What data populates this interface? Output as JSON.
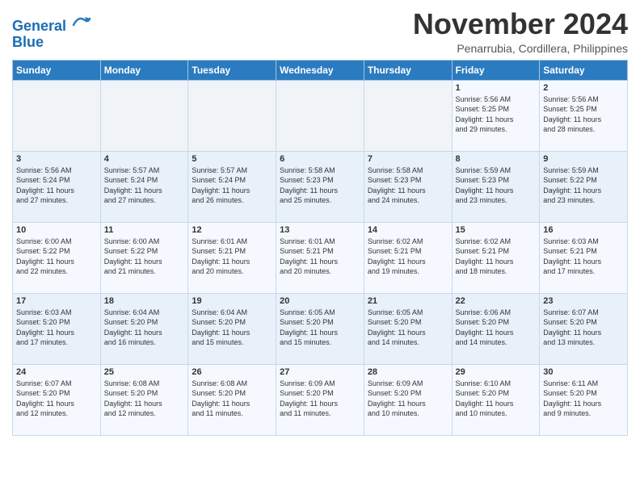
{
  "header": {
    "logo_line1": "General",
    "logo_line2": "Blue",
    "month": "November 2024",
    "location": "Penarrubia, Cordillera, Philippines"
  },
  "weekdays": [
    "Sunday",
    "Monday",
    "Tuesday",
    "Wednesday",
    "Thursday",
    "Friday",
    "Saturday"
  ],
  "weeks": [
    [
      {
        "day": "",
        "info": ""
      },
      {
        "day": "",
        "info": ""
      },
      {
        "day": "",
        "info": ""
      },
      {
        "day": "",
        "info": ""
      },
      {
        "day": "",
        "info": ""
      },
      {
        "day": "1",
        "info": "Sunrise: 5:56 AM\nSunset: 5:25 PM\nDaylight: 11 hours\nand 29 minutes."
      },
      {
        "day": "2",
        "info": "Sunrise: 5:56 AM\nSunset: 5:25 PM\nDaylight: 11 hours\nand 28 minutes."
      }
    ],
    [
      {
        "day": "3",
        "info": "Sunrise: 5:56 AM\nSunset: 5:24 PM\nDaylight: 11 hours\nand 27 minutes."
      },
      {
        "day": "4",
        "info": "Sunrise: 5:57 AM\nSunset: 5:24 PM\nDaylight: 11 hours\nand 27 minutes."
      },
      {
        "day": "5",
        "info": "Sunrise: 5:57 AM\nSunset: 5:24 PM\nDaylight: 11 hours\nand 26 minutes."
      },
      {
        "day": "6",
        "info": "Sunrise: 5:58 AM\nSunset: 5:23 PM\nDaylight: 11 hours\nand 25 minutes."
      },
      {
        "day": "7",
        "info": "Sunrise: 5:58 AM\nSunset: 5:23 PM\nDaylight: 11 hours\nand 24 minutes."
      },
      {
        "day": "8",
        "info": "Sunrise: 5:59 AM\nSunset: 5:23 PM\nDaylight: 11 hours\nand 23 minutes."
      },
      {
        "day": "9",
        "info": "Sunrise: 5:59 AM\nSunset: 5:22 PM\nDaylight: 11 hours\nand 23 minutes."
      }
    ],
    [
      {
        "day": "10",
        "info": "Sunrise: 6:00 AM\nSunset: 5:22 PM\nDaylight: 11 hours\nand 22 minutes."
      },
      {
        "day": "11",
        "info": "Sunrise: 6:00 AM\nSunset: 5:22 PM\nDaylight: 11 hours\nand 21 minutes."
      },
      {
        "day": "12",
        "info": "Sunrise: 6:01 AM\nSunset: 5:21 PM\nDaylight: 11 hours\nand 20 minutes."
      },
      {
        "day": "13",
        "info": "Sunrise: 6:01 AM\nSunset: 5:21 PM\nDaylight: 11 hours\nand 20 minutes."
      },
      {
        "day": "14",
        "info": "Sunrise: 6:02 AM\nSunset: 5:21 PM\nDaylight: 11 hours\nand 19 minutes."
      },
      {
        "day": "15",
        "info": "Sunrise: 6:02 AM\nSunset: 5:21 PM\nDaylight: 11 hours\nand 18 minutes."
      },
      {
        "day": "16",
        "info": "Sunrise: 6:03 AM\nSunset: 5:21 PM\nDaylight: 11 hours\nand 17 minutes."
      }
    ],
    [
      {
        "day": "17",
        "info": "Sunrise: 6:03 AM\nSunset: 5:20 PM\nDaylight: 11 hours\nand 17 minutes."
      },
      {
        "day": "18",
        "info": "Sunrise: 6:04 AM\nSunset: 5:20 PM\nDaylight: 11 hours\nand 16 minutes."
      },
      {
        "day": "19",
        "info": "Sunrise: 6:04 AM\nSunset: 5:20 PM\nDaylight: 11 hours\nand 15 minutes."
      },
      {
        "day": "20",
        "info": "Sunrise: 6:05 AM\nSunset: 5:20 PM\nDaylight: 11 hours\nand 15 minutes."
      },
      {
        "day": "21",
        "info": "Sunrise: 6:05 AM\nSunset: 5:20 PM\nDaylight: 11 hours\nand 14 minutes."
      },
      {
        "day": "22",
        "info": "Sunrise: 6:06 AM\nSunset: 5:20 PM\nDaylight: 11 hours\nand 14 minutes."
      },
      {
        "day": "23",
        "info": "Sunrise: 6:07 AM\nSunset: 5:20 PM\nDaylight: 11 hours\nand 13 minutes."
      }
    ],
    [
      {
        "day": "24",
        "info": "Sunrise: 6:07 AM\nSunset: 5:20 PM\nDaylight: 11 hours\nand 12 minutes."
      },
      {
        "day": "25",
        "info": "Sunrise: 6:08 AM\nSunset: 5:20 PM\nDaylight: 11 hours\nand 12 minutes."
      },
      {
        "day": "26",
        "info": "Sunrise: 6:08 AM\nSunset: 5:20 PM\nDaylight: 11 hours\nand 11 minutes."
      },
      {
        "day": "27",
        "info": "Sunrise: 6:09 AM\nSunset: 5:20 PM\nDaylight: 11 hours\nand 11 minutes."
      },
      {
        "day": "28",
        "info": "Sunrise: 6:09 AM\nSunset: 5:20 PM\nDaylight: 11 hours\nand 10 minutes."
      },
      {
        "day": "29",
        "info": "Sunrise: 6:10 AM\nSunset: 5:20 PM\nDaylight: 11 hours\nand 10 minutes."
      },
      {
        "day": "30",
        "info": "Sunrise: 6:11 AM\nSunset: 5:20 PM\nDaylight: 11 hours\nand 9 minutes."
      }
    ]
  ]
}
